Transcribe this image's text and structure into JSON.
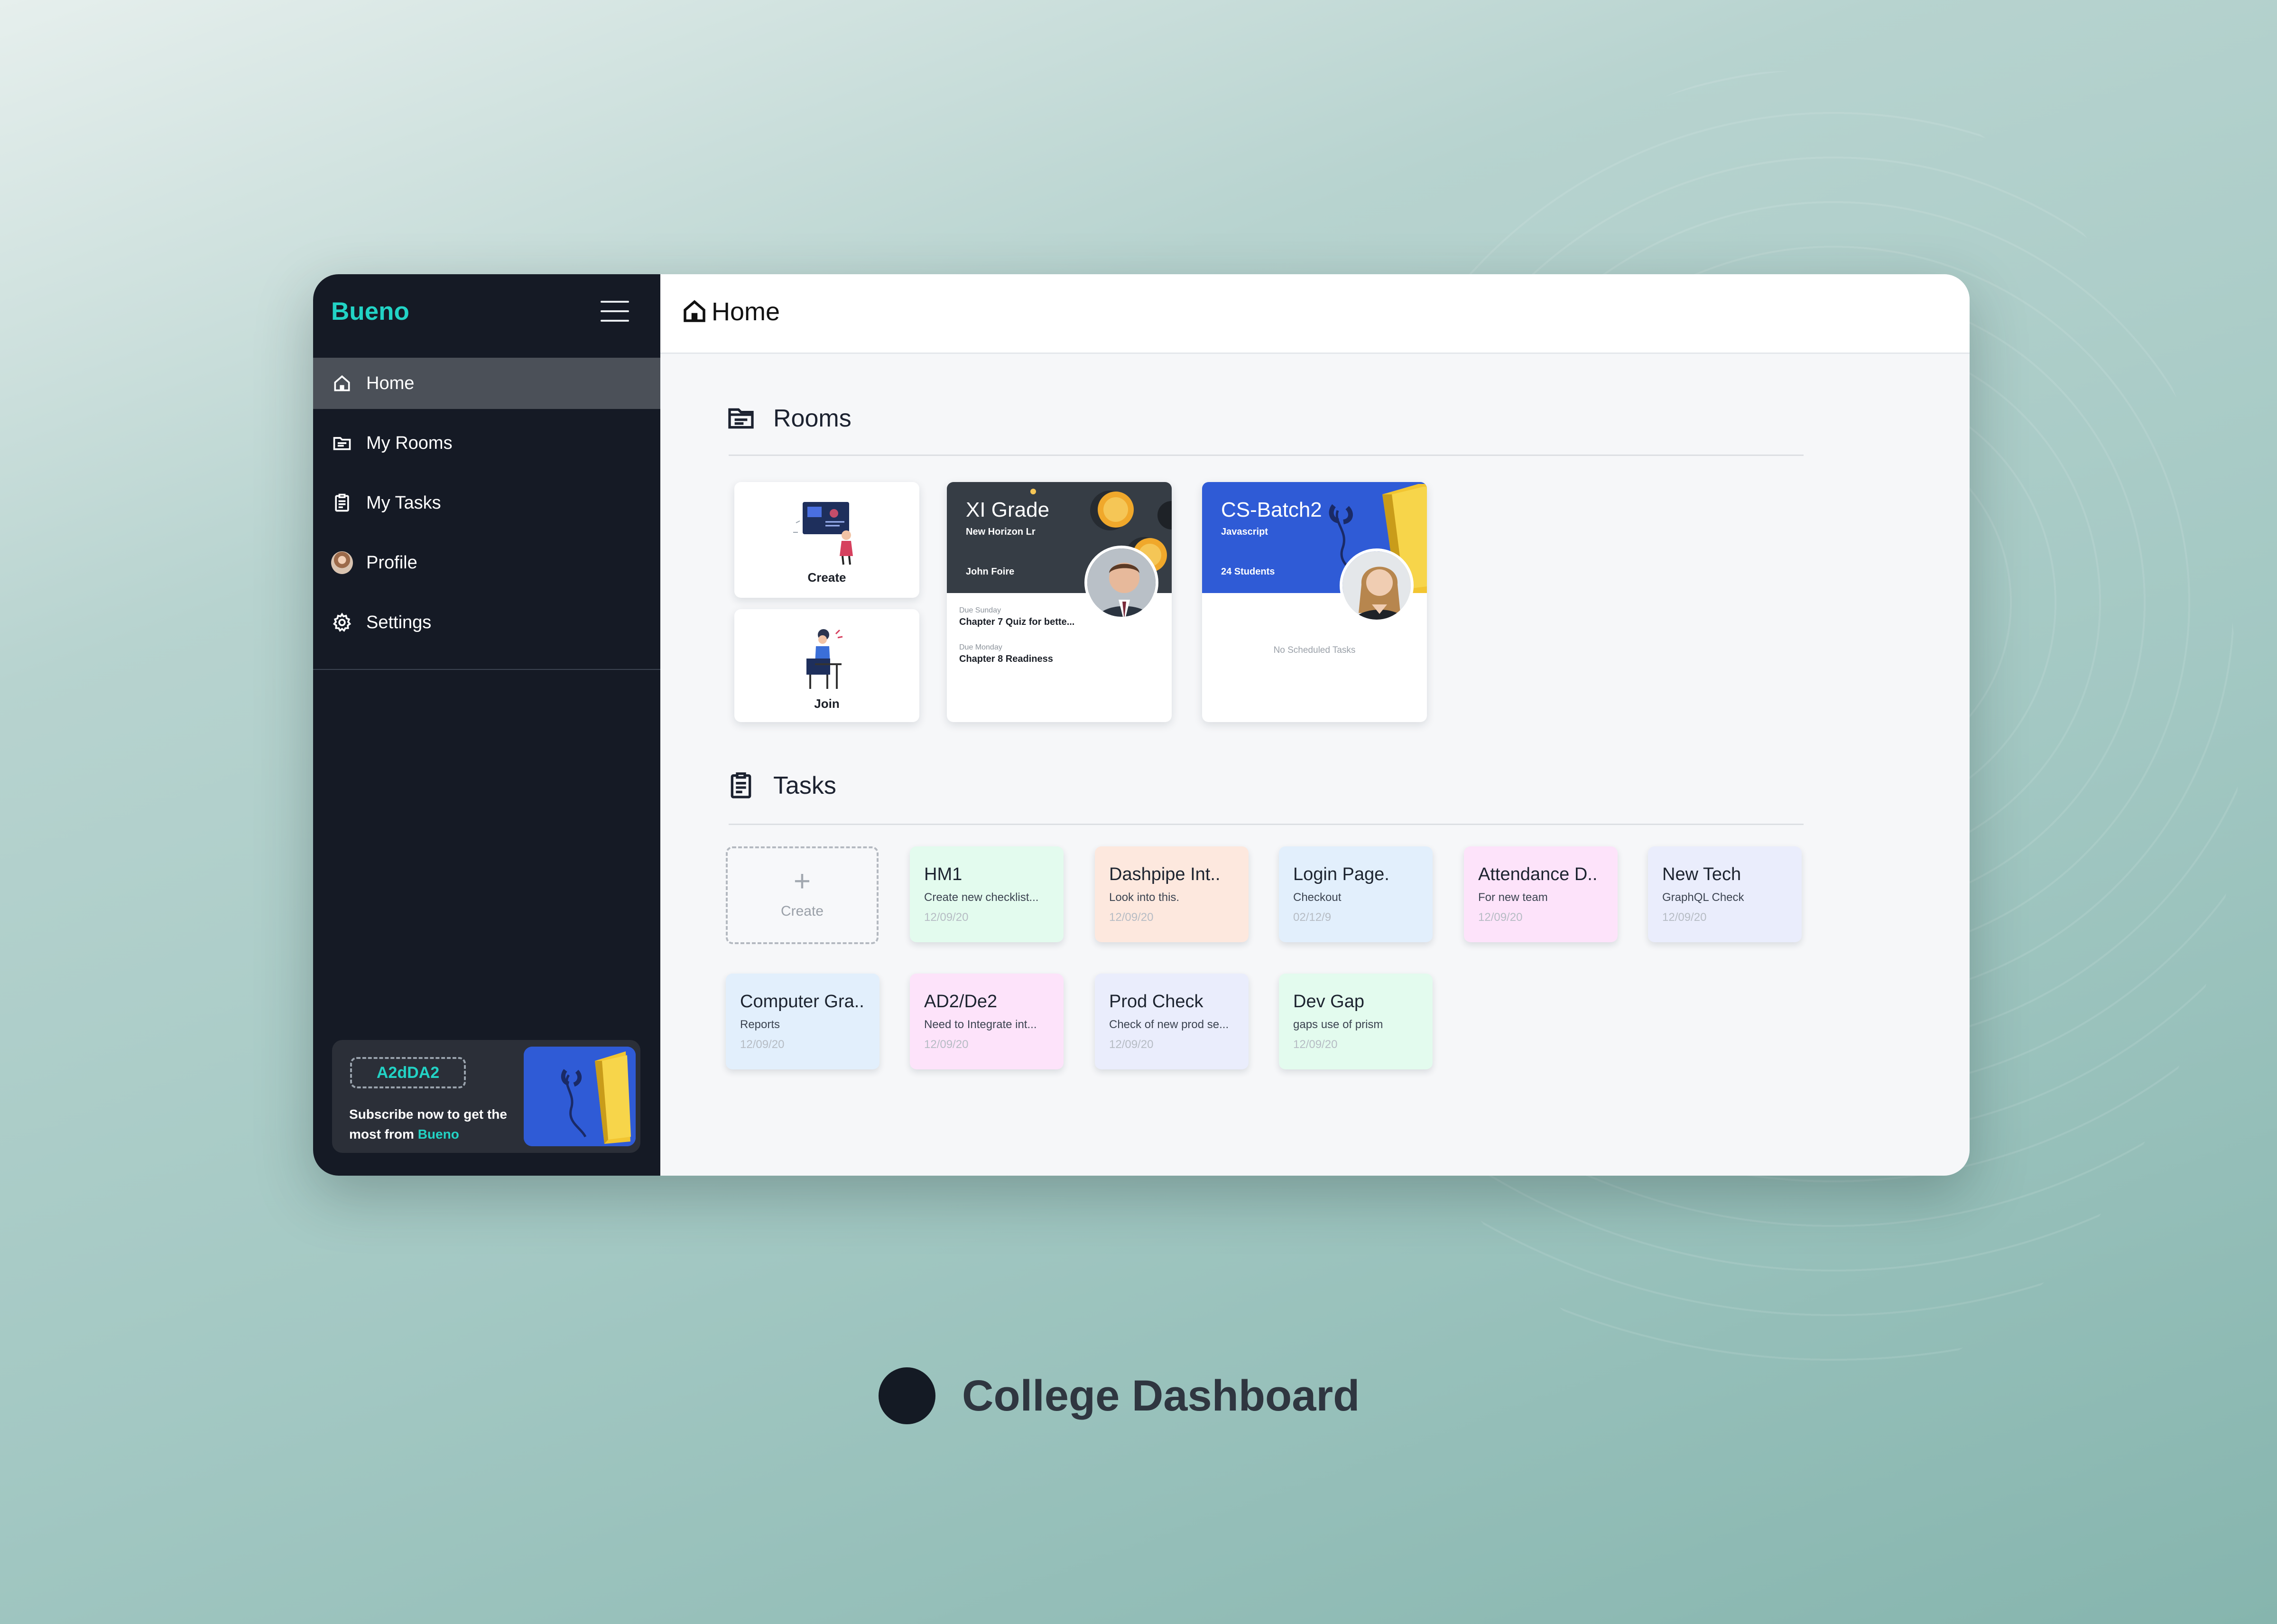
{
  "app": {
    "brand": "Bueno",
    "page_title": "Home"
  },
  "sidebar": {
    "items": [
      {
        "label": "Home",
        "icon": "home-icon",
        "active": true
      },
      {
        "label": "My Rooms",
        "icon": "folder-icon"
      },
      {
        "label": "My Tasks",
        "icon": "clipboard-icon"
      },
      {
        "label": "Profile",
        "icon": "avatar"
      },
      {
        "label": "Settings",
        "icon": "gear-icon"
      }
    ],
    "promo": {
      "code": "A2dDA2",
      "text_prefix": "Subscribe now to get the most from",
      "brand": "Bueno"
    }
  },
  "rooms": {
    "heading": "Rooms",
    "create_label": "Create",
    "join_label": "Join",
    "cards": [
      {
        "title": "XI Grade",
        "subtitle": "New Horizon Lr",
        "meta": "John Foire",
        "color": "#363d45",
        "tasks": [
          {
            "due": "Due Sunday",
            "title": "Chapter 7 Quiz for bette..."
          },
          {
            "due": "Due Monday",
            "title": "Chapter 8 Readiness"
          }
        ]
      },
      {
        "title": "CS-Batch2",
        "subtitle": "Javascript",
        "meta": "24 Students",
        "color": "#2f5bd6",
        "empty_note": "No Scheduled Tasks"
      }
    ]
  },
  "tasks": {
    "heading": "Tasks",
    "create_label": "Create",
    "items": [
      {
        "title": "HM1",
        "desc": "Create new checklist...",
        "date": "12/09/20",
        "color": "#e3fbee"
      },
      {
        "title": "Dashpipe Int..",
        "desc": "Look into this.",
        "date": "12/09/20",
        "color": "#fde8de"
      },
      {
        "title": "Login Page.",
        "desc": "Checkout",
        "date": "02/12/9",
        "color": "#e2effc"
      },
      {
        "title": "Attendance D..",
        "desc": "For new team",
        "date": "12/09/20",
        "color": "#fde3fa"
      },
      {
        "title": "New Tech",
        "desc": "GraphQL Check",
        "date": "12/09/20",
        "color": "#eaedfc"
      },
      {
        "title": "Computer Gra..",
        "desc": "Reports",
        "date": "12/09/20",
        "color": "#e2effc"
      },
      {
        "title": "AD2/De2",
        "desc": "Need to Integrate int...",
        "date": "12/09/20",
        "color": "#fde3fa"
      },
      {
        "title": "Prod Check",
        "desc": "Check of new prod se...",
        "date": "12/09/20",
        "color": "#eaedfc"
      },
      {
        "title": "Dev Gap",
        "desc": "gaps use of prism",
        "date": "12/09/20",
        "color": "#e3fbee"
      }
    ]
  },
  "caption": "College Dashboard"
}
